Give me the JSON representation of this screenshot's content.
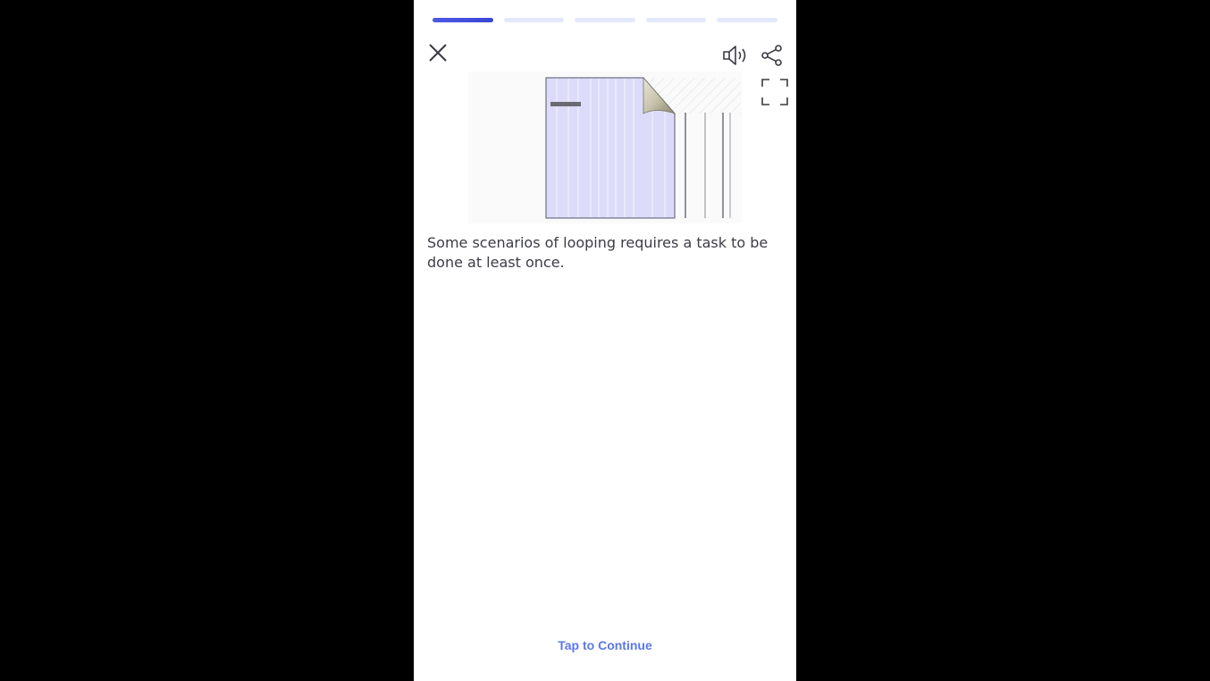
{
  "lesson": {
    "progress": {
      "total_steps": 5,
      "current_step": 1
    },
    "toolbar": {
      "close_icon": "close-icon",
      "sound_icon": "speaker-icon",
      "share_icon": "share-icon",
      "fullscreen_icon": "fullscreen-icon"
    },
    "illustration_icon": "page-curl-illustration",
    "caption": "Some scenarios of looping requires a task to be done at least once.",
    "continue_label": "Tap to Continue"
  },
  "colors": {
    "accent": "#3f4fdc",
    "progress_inactive": "#e4e8fb",
    "link": "#5b78e8",
    "text": "#3c3c46"
  }
}
